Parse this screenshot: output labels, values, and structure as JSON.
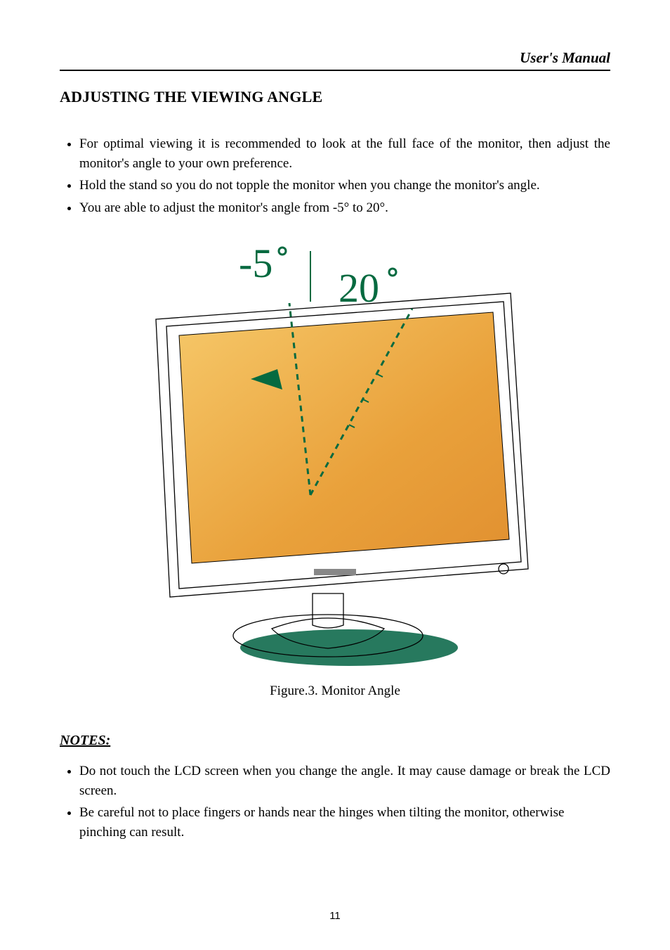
{
  "header": {
    "right_title": "User's Manual"
  },
  "section": {
    "heading": "ADJUSTING THE VIEWING ANGLE"
  },
  "instructions": [
    "For optimal viewing it is recommended to look at the full face of the monitor, then adjust the monitor's angle to your own preference.",
    "Hold the stand so you do not topple the monitor when you change the monitor's angle.",
    "You are able to adjust the monitor's angle from -5° to 20°."
  ],
  "figure": {
    "label_neg": "-5",
    "label_pos": "20",
    "degree_symbol": "°",
    "caption_prefix": "Figure.3.",
    "caption_text": "Monitor Angle"
  },
  "notes": {
    "heading": "NOTES:",
    "items": [
      "Do not touch the LCD screen when you change the angle. It may cause damage or break the LCD screen.",
      "Be careful not to place fingers or hands near the hinges when tilting the monitor, otherwise pinching can result."
    ]
  },
  "page_number": "11"
}
